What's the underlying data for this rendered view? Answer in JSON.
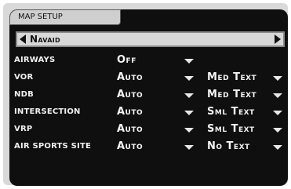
{
  "header": {
    "title": "MAP SETUP"
  },
  "selector": {
    "value": "Navaid"
  },
  "rows": [
    {
      "label": "AIRWAYS",
      "value": "Off",
      "text_size": ""
    },
    {
      "label": "VOR",
      "value": "Auto",
      "text_size": "Med Text"
    },
    {
      "label": "NDB",
      "value": "Auto",
      "text_size": "Med Text"
    },
    {
      "label": "INTERSECTION",
      "value": "Auto",
      "text_size": "Sml Text"
    },
    {
      "label": "VRP",
      "value": "Auto",
      "text_size": "Sml Text"
    },
    {
      "label": "AIR SPORTS SITE",
      "value": "Auto",
      "text_size": "No Text"
    }
  ],
  "icons": {
    "left": "arrow-left-icon",
    "right": "arrow-right-icon",
    "dropdown": "dropdown-arrow-icon"
  }
}
